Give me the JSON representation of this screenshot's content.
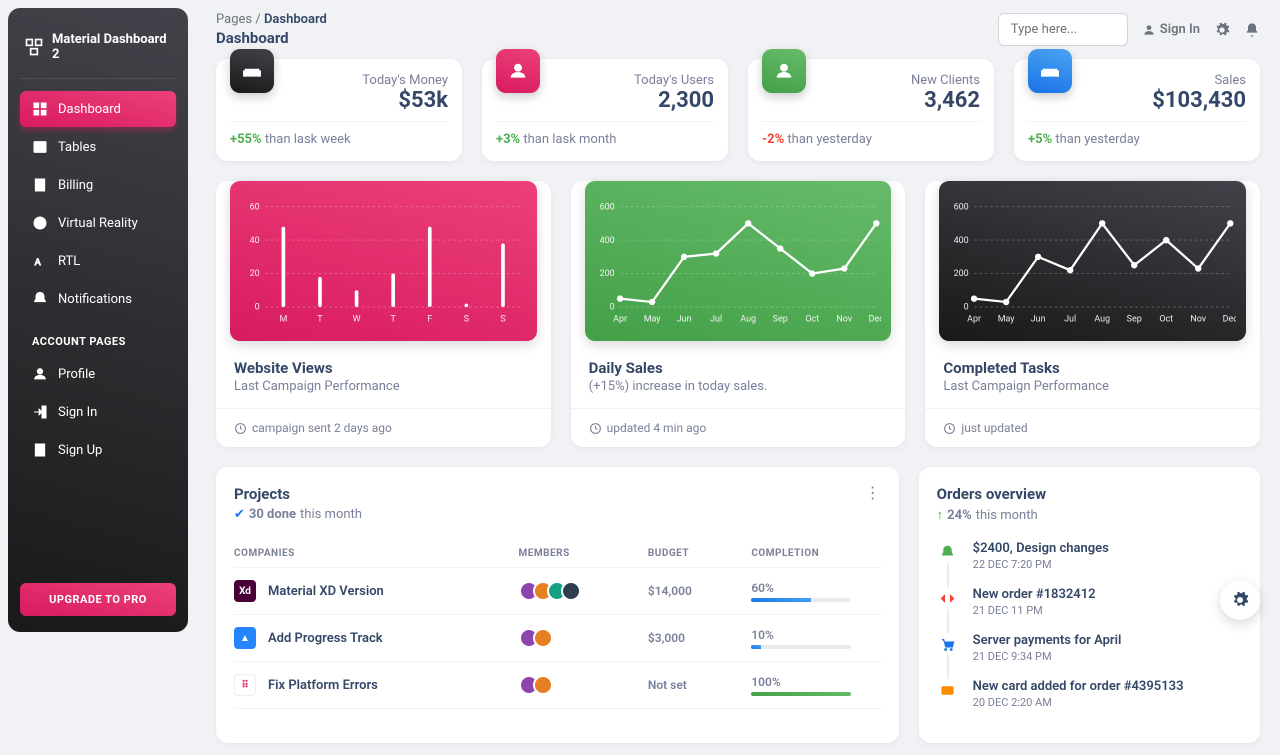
{
  "brand": "Material Dashboard 2",
  "sidebar": {
    "items": [
      {
        "label": "Dashboard",
        "icon": "dashboard",
        "active": true
      },
      {
        "label": "Tables",
        "icon": "table"
      },
      {
        "label": "Billing",
        "icon": "receipt"
      },
      {
        "label": "Virtual Reality",
        "icon": "vr"
      },
      {
        "label": "RTL",
        "icon": "rtl"
      },
      {
        "label": "Notifications",
        "icon": "bell"
      }
    ],
    "section_label": "ACCOUNT PAGES",
    "account": [
      {
        "label": "Profile",
        "icon": "user"
      },
      {
        "label": "Sign In",
        "icon": "signin"
      },
      {
        "label": "Sign Up",
        "icon": "signup"
      }
    ],
    "upgrade": "UPGRADE TO PRO"
  },
  "breadcrumb": {
    "root": "Pages",
    "sep": "/",
    "current": "Dashboard",
    "title": "Dashboard"
  },
  "search": {
    "placeholder": "Type here..."
  },
  "topnav": {
    "signin": "Sign In"
  },
  "stats": [
    {
      "label": "Today's Money",
      "value": "$53k",
      "change": "+55%",
      "trend": "pos",
      "note": " than lask week",
      "icon": "weekend",
      "color": "dark"
    },
    {
      "label": "Today's Users",
      "value": "2,300",
      "change": "+3%",
      "trend": "pos",
      "note": " than lask month",
      "icon": "user",
      "color": "pink"
    },
    {
      "label": "New Clients",
      "value": "3,462",
      "change": "-2%",
      "trend": "neg",
      "note": " than yesterday",
      "icon": "user",
      "color": "green"
    },
    {
      "label": "Sales",
      "value": "$103,430",
      "change": "+5%",
      "trend": "pos",
      "note": " than yesterday",
      "icon": "weekend",
      "color": "blue"
    }
  ],
  "charts": [
    {
      "title": "Website Views",
      "sub": "Last Campaign Performance",
      "foot": "campaign sent 2 days ago",
      "color": "pink"
    },
    {
      "title": "Daily Sales",
      "sub": "(+15%) increase in today sales.",
      "foot": "updated 4 min ago",
      "color": "green"
    },
    {
      "title": "Completed Tasks",
      "sub": "Last Campaign Performance",
      "foot": "just updated",
      "color": "dark"
    }
  ],
  "chart_data": [
    {
      "type": "bar",
      "categories": [
        "M",
        "T",
        "W",
        "T",
        "F",
        "S",
        "S"
      ],
      "values": [
        48,
        18,
        10,
        20,
        48,
        2,
        38
      ],
      "ylim": [
        0,
        60
      ],
      "yticks": [
        0,
        20,
        40,
        60
      ]
    },
    {
      "type": "line",
      "categories": [
        "Apr",
        "May",
        "Jun",
        "Jul",
        "Aug",
        "Sep",
        "Oct",
        "Nov",
        "Dec"
      ],
      "values": [
        50,
        30,
        300,
        320,
        500,
        350,
        200,
        230,
        500
      ],
      "ylim": [
        0,
        600
      ],
      "yticks": [
        0,
        200,
        400,
        600
      ]
    },
    {
      "type": "line",
      "categories": [
        "Apr",
        "May",
        "Jun",
        "Jul",
        "Aug",
        "Sep",
        "Oct",
        "Nov",
        "Dec"
      ],
      "values": [
        50,
        30,
        300,
        220,
        500,
        250,
        400,
        230,
        500
      ],
      "ylim": [
        0,
        600
      ],
      "yticks": [
        0,
        200,
        400,
        600
      ]
    }
  ],
  "projects": {
    "title": "Projects",
    "done_count": "30 done",
    "done_suffix": " this month",
    "columns": [
      "COMPANIES",
      "MEMBERS",
      "BUDGET",
      "COMPLETION"
    ],
    "rows": [
      {
        "name": "Material XD Version",
        "logo_bg": "#470137",
        "logo_text": "Xd",
        "members": 4,
        "budget": "$14,000",
        "completion": 60
      },
      {
        "name": "Add Progress Track",
        "logo_bg": "#2684FF",
        "logo_text": "▲",
        "members": 2,
        "budget": "$3,000",
        "completion": 10
      },
      {
        "name": "Fix Platform Errors",
        "logo_bg": "#fff",
        "logo_text": "⠿",
        "members": 2,
        "budget": "Not set",
        "completion": 100
      }
    ]
  },
  "orders": {
    "title": "Orders overview",
    "pct": "24%",
    "pct_suffix": " this month",
    "items": [
      {
        "title": "$2400, Design changes",
        "time": "22 DEC 7:20 PM",
        "color": "#4caf50",
        "icon": "bell"
      },
      {
        "title": "New order #1832412",
        "time": "21 DEC 11 PM",
        "color": "#f44335",
        "icon": "code"
      },
      {
        "title": "Server payments for April",
        "time": "21 DEC 9:34 PM",
        "color": "#1a73e8",
        "icon": "cart"
      },
      {
        "title": "New card added for order #4395133",
        "time": "20 DEC 2:20 AM",
        "color": "#fb8c00",
        "icon": "card"
      }
    ]
  },
  "colors": {
    "avatar": [
      "#8e44ad",
      "#e67e22",
      "#16a085",
      "#2c3e50"
    ]
  }
}
